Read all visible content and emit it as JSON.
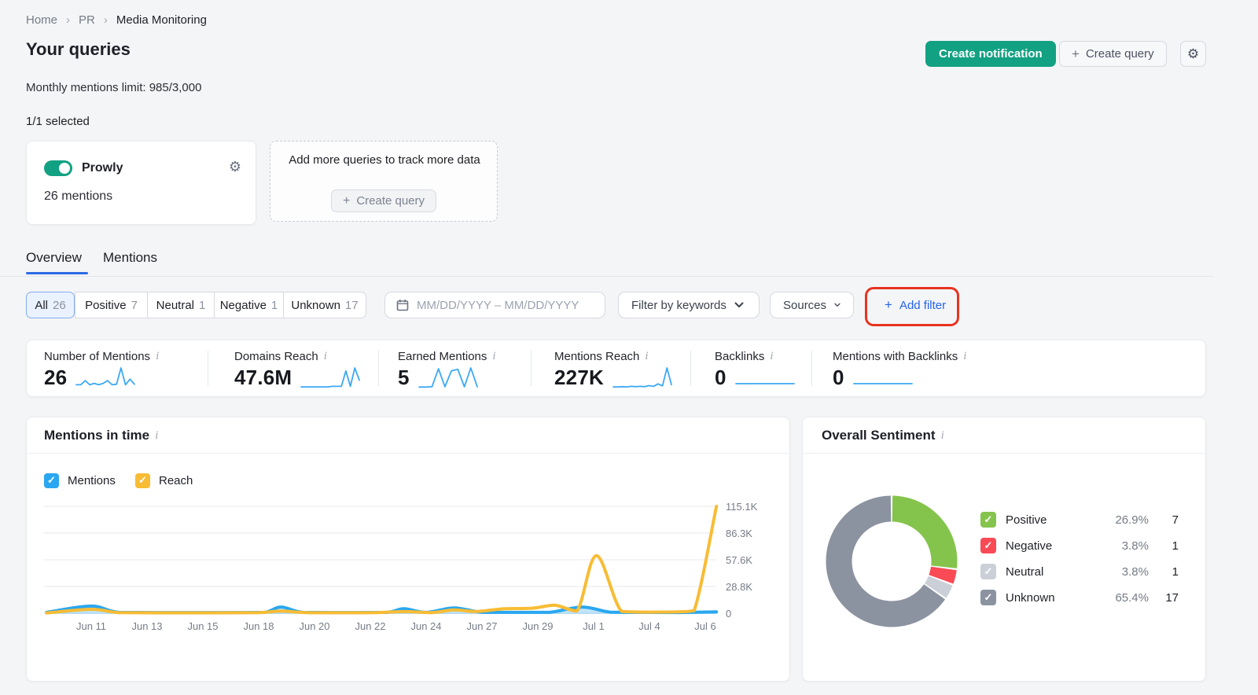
{
  "theme": {
    "green": "#12A182",
    "blue": "#2F6BE4",
    "link_blue": "#2563EB",
    "annotation_red": "#E8331F",
    "spark_blue": "#3BA9F4"
  },
  "breadcrumb": {
    "items": [
      "Home",
      "PR",
      "Media Monitoring"
    ],
    "separator": "›"
  },
  "header": {
    "title": "Your queries",
    "limit_label": "Monthly mentions limit: 985/3,000",
    "selected_label": "1/1 selected"
  },
  "actions": {
    "create_notification": "Create notification",
    "create_query": "Create query",
    "plus_icon": "+",
    "settings_icon": "⚙"
  },
  "query_card": {
    "name": "Prowly",
    "mentions": "26 mentions",
    "toggle_state": "on",
    "settings_icon": "⚙"
  },
  "add_query_card": {
    "text": "Add more queries to track more data",
    "button_label": "Create query",
    "plus_icon": "+"
  },
  "tabs": {
    "items": [
      {
        "label": "Overview",
        "active": true
      },
      {
        "label": "Mentions",
        "active": false
      }
    ]
  },
  "filter_bar": {
    "segments": [
      {
        "label": "All",
        "count": "26",
        "selected": true
      },
      {
        "label": "Positive",
        "count": "7",
        "selected": false
      },
      {
        "label": "Neutral",
        "count": "1",
        "selected": false
      },
      {
        "label": "Negative",
        "count": "1",
        "selected": false
      },
      {
        "label": "Unknown",
        "count": "17",
        "selected": false
      }
    ],
    "date_placeholder": "MM/DD/YYYY  –  MM/DD/YYYY",
    "keywords_label": "Filter by keywords",
    "sources_label": "Sources",
    "add_filter_label": "Add filter",
    "add_filter_plus": "+"
  },
  "metrics": {
    "items": [
      {
        "label": "Number of Mentions",
        "value": "26",
        "spark": [
          1,
          1,
          2.5,
          1,
          1.5,
          1,
          1.5,
          2.5,
          1,
          1.2,
          7,
          1,
          3,
          1.2
        ]
      },
      {
        "label": "Domains Reach",
        "value": "47.6M",
        "spark": [
          0.3,
          0.3,
          0.3,
          0.3,
          0.3,
          0.3,
          0.3,
          0.5,
          0.5,
          0.5,
          6.8,
          0.5,
          8,
          3
        ]
      },
      {
        "label": "Earned Mentions",
        "value": "5",
        "spark": [
          0.2,
          0.2,
          0.3,
          6.5,
          0.3,
          5.8,
          6.3,
          0.3,
          6.8,
          0.3
        ]
      },
      {
        "label": "Mentions Reach",
        "value": "227K",
        "spark": [
          0.3,
          0.3,
          0.4,
          0.3,
          0.5,
          0.4,
          0.5,
          0.4,
          0.8,
          0.5,
          1.5,
          0.7,
          8,
          1.2
        ]
      },
      {
        "label": "Backlinks",
        "value": "0",
        "spark": [
          0.2,
          0.2,
          0.2,
          0.2,
          0.2,
          0.2,
          0.2,
          0.2
        ]
      },
      {
        "label": "Mentions with Backlinks",
        "value": "0",
        "spark": [
          0.2,
          0.2,
          0.2,
          0.2,
          0.2,
          0.2,
          0.2,
          0.2
        ]
      }
    ]
  },
  "chart_data": [
    {
      "type": "line",
      "title": "Mentions in time",
      "legend": [
        {
          "label": "Mentions",
          "color": "#2AA7F0"
        },
        {
          "label": "Reach",
          "color": "#F8BC34"
        }
      ],
      "x_ticks": [
        "Jun 11",
        "Jun 13",
        "Jun 15",
        "Jun 18",
        "Jun 20",
        "Jun 22",
        "Jun 24",
        "Jun 27",
        "Jun 29",
        "Jul 1",
        "Jul 4",
        "Jul 6"
      ],
      "y_ticks": [
        {
          "label": "115.1K",
          "value": 115100
        },
        {
          "label": "86.3K",
          "value": 86300
        },
        {
          "label": "57.6K",
          "value": 57600
        },
        {
          "label": "28.8K",
          "value": 28800
        },
        {
          "label": "0",
          "value": 0
        }
      ],
      "ylim": [
        0,
        115100
      ],
      "grid": true,
      "legend_position": "top-left",
      "series": [
        {
          "name": "Mentions",
          "color": "#2AA7F0",
          "axis_max": 60,
          "fill": "rgba(42,167,240,0.30)",
          "values_at_ticks": [
            4,
            0,
            0,
            3,
            0,
            2,
            3,
            0,
            3,
            1,
            0,
            1
          ],
          "render_points": [
            [
              -0.8,
              0.5
            ],
            [
              0,
              4
            ],
            [
              0.5,
              0.5
            ],
            [
              1.5,
              0.4
            ],
            [
              2.5,
              0.4
            ],
            [
              3.1,
              0.5
            ],
            [
              3.4,
              3.5
            ],
            [
              3.8,
              0.5
            ],
            [
              4.6,
              0.4
            ],
            [
              5.3,
              0.5
            ],
            [
              5.6,
              2.5
            ],
            [
              6,
              0.5
            ],
            [
              6.5,
              3
            ],
            [
              7,
              0.5
            ],
            [
              7.6,
              0.5
            ],
            [
              8.2,
              0.5
            ],
            [
              8.8,
              3.5
            ],
            [
              9.3,
              0.6
            ],
            [
              9.9,
              0.5
            ],
            [
              10.5,
              0.4
            ],
            [
              11.2,
              0.8
            ]
          ]
        },
        {
          "name": "Reach",
          "color": "#F8BC34",
          "axis_max": 115100,
          "fill": "none",
          "values_at_ticks": [
            4200,
            400,
            500,
            2300,
            500,
            1700,
            3600,
            5400,
            8800,
            62000,
            1300,
            115100
          ],
          "render_points": [
            [
              -0.8,
              300
            ],
            [
              0,
              4200
            ],
            [
              0.5,
              600
            ],
            [
              1.2,
              400
            ],
            [
              2.2,
              400
            ],
            [
              3,
              600
            ],
            [
              3.4,
              2300
            ],
            [
              3.9,
              500
            ],
            [
              4.6,
              500
            ],
            [
              5.1,
              600
            ],
            [
              5.6,
              1800
            ],
            [
              6.1,
              700
            ],
            [
              6.5,
              3600
            ],
            [
              6.9,
              1900
            ],
            [
              7.4,
              4800
            ],
            [
              7.9,
              5400
            ],
            [
              8.3,
              8600
            ],
            [
              8.7,
              2400
            ],
            [
              9.05,
              62000
            ],
            [
              9.5,
              2000
            ],
            [
              10,
              1200
            ],
            [
              10.5,
              1400
            ],
            [
              10.8,
              2800
            ],
            [
              11.2,
              115100
            ]
          ]
        }
      ]
    },
    {
      "type": "pie",
      "title": "Overall Sentiment",
      "labels": [
        "Positive",
        "Negative",
        "Neutral",
        "Unknown"
      ],
      "values": [
        7,
        1,
        1,
        17
      ],
      "percents": [
        "26.9%",
        "3.8%",
        "3.8%",
        "65.4%"
      ],
      "colors": [
        "#85C44C",
        "#F94A55",
        "#CBD0D8",
        "#8B92A0"
      ],
      "legend": [
        {
          "label": "Positive",
          "pct": "26.9%",
          "count": "7",
          "color": "#85C44C"
        },
        {
          "label": "Negative",
          "pct": "3.8%",
          "count": "1",
          "color": "#F94A55"
        },
        {
          "label": "Neutral",
          "pct": "3.8%",
          "count": "1",
          "color": "#CBD0D8"
        },
        {
          "label": "Unknown",
          "pct": "65.4%",
          "count": "17",
          "color": "#8B92A0"
        }
      ]
    }
  ]
}
